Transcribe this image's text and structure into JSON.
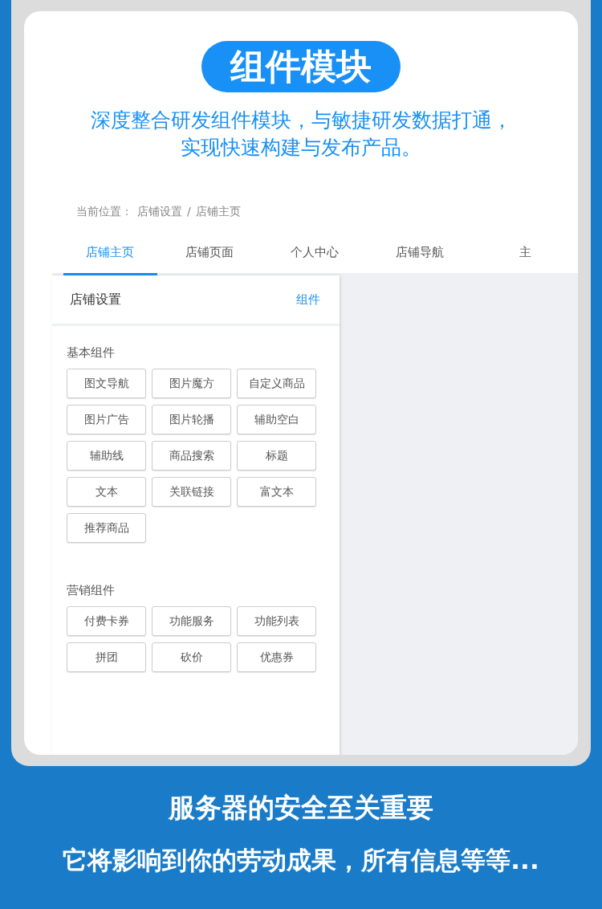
{
  "header": {
    "badge": "组件模块",
    "subtitle_lines": [
      "深度整合研发组件模块，与敏捷研发数据打通，",
      "实现快速构建与发布产品。"
    ]
  },
  "breadcrumb": {
    "label": "当前位置：",
    "items": [
      "店铺设置",
      "店铺主页"
    ],
    "separator": "/"
  },
  "tabs": [
    {
      "label": "店铺主页",
      "selected": true
    },
    {
      "label": "店铺页面",
      "selected": false
    },
    {
      "label": "个人中心",
      "selected": false
    },
    {
      "label": "店铺导航",
      "selected": false
    },
    {
      "label": "主",
      "selected": false
    }
  ],
  "panel": {
    "title": "店铺设置",
    "link": "组件",
    "groups": [
      {
        "title": "基本组件",
        "items": [
          "图文导航",
          "图片魔方",
          "自定义商品",
          "图片广告",
          "图片轮播",
          "辅助空白",
          "辅助线",
          "商品搜索",
          "标题",
          "文本",
          "关联链接",
          "富文本",
          "推荐商品"
        ]
      },
      {
        "title": "营销组件",
        "items": [
          "付费卡券",
          "功能服务",
          "功能列表",
          "拼团",
          "砍价",
          "优惠券"
        ]
      }
    ]
  },
  "footer": {
    "lines": [
      "服务器的安全至关重要",
      "它将影响到你的劳动成果，所有信息等等..."
    ]
  }
}
